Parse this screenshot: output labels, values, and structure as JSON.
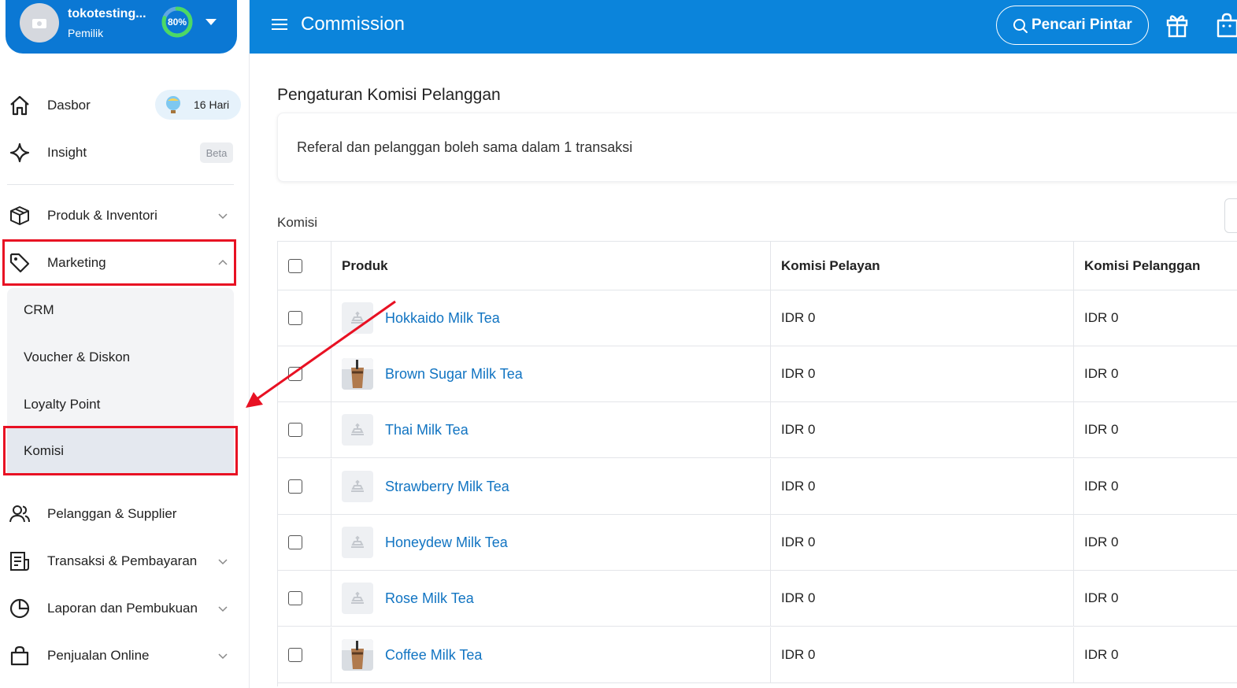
{
  "store": {
    "name": "tokotesting...",
    "role": "Pemilik",
    "setup_progress_text": "80%",
    "setup_progress": 0.8
  },
  "header": {
    "title": "Commission",
    "search_label": "Pencari Pintar"
  },
  "sidebar": {
    "items": [
      {
        "label": "Dasbor",
        "icon": "home-icon",
        "badge": "16 Hari"
      },
      {
        "label": "Insight",
        "icon": "sparkle-icon",
        "badge": "Beta"
      },
      {
        "label": "Produk & Inventori",
        "icon": "box-icon"
      },
      {
        "label": "Marketing",
        "icon": "tag-icon",
        "expanded": true
      },
      {
        "label": "Pelanggan & Supplier",
        "icon": "users-icon"
      },
      {
        "label": "Transaksi & Pembayaran",
        "icon": "receipt-icon"
      },
      {
        "label": "Laporan dan Pembukuan",
        "icon": "pie-chart-icon"
      },
      {
        "label": "Penjualan Online",
        "icon": "shopping-bag-icon"
      }
    ],
    "marketing_submenu": [
      "CRM",
      "Voucher & Diskon",
      "Loyalty Point",
      "Komisi"
    ],
    "active_submenu": "Komisi"
  },
  "main": {
    "section_title": "Pengaturan Komisi Pelanggan",
    "info_text": "Referal dan pelanggan boleh sama dalam 1 transaksi",
    "table_label": "Komisi",
    "columns": [
      "Produk",
      "Komisi Pelayan",
      "Komisi Pelanggan"
    ],
    "rows": [
      {
        "product": "Hokkaido Milk Tea",
        "komisi_pelayan": "IDR 0",
        "komisi_pelanggan": "IDR 0",
        "photo": false
      },
      {
        "product": "Brown Sugar Milk Tea",
        "komisi_pelayan": "IDR 0",
        "komisi_pelanggan": "IDR 0",
        "photo": true
      },
      {
        "product": "Thai Milk Tea",
        "komisi_pelayan": "IDR 0",
        "komisi_pelanggan": "IDR 0",
        "photo": false
      },
      {
        "product": "Strawberry Milk Tea",
        "komisi_pelayan": "IDR 0",
        "komisi_pelanggan": "IDR 0",
        "photo": false
      },
      {
        "product": "Honeydew Milk Tea",
        "komisi_pelayan": "IDR 0",
        "komisi_pelanggan": "IDR 0",
        "photo": false
      },
      {
        "product": "Rose Milk Tea",
        "komisi_pelayan": "IDR 0",
        "komisi_pelanggan": "IDR 0",
        "photo": false
      },
      {
        "product": "Coffee Milk Tea",
        "komisi_pelayan": "IDR 0",
        "komisi_pelanggan": "IDR 0",
        "photo": true
      }
    ]
  },
  "colors": {
    "header_blue": "#0b84db",
    "link_blue": "#1174c2",
    "highlight_red": "#e81123",
    "progress_green": "#4cd964"
  }
}
